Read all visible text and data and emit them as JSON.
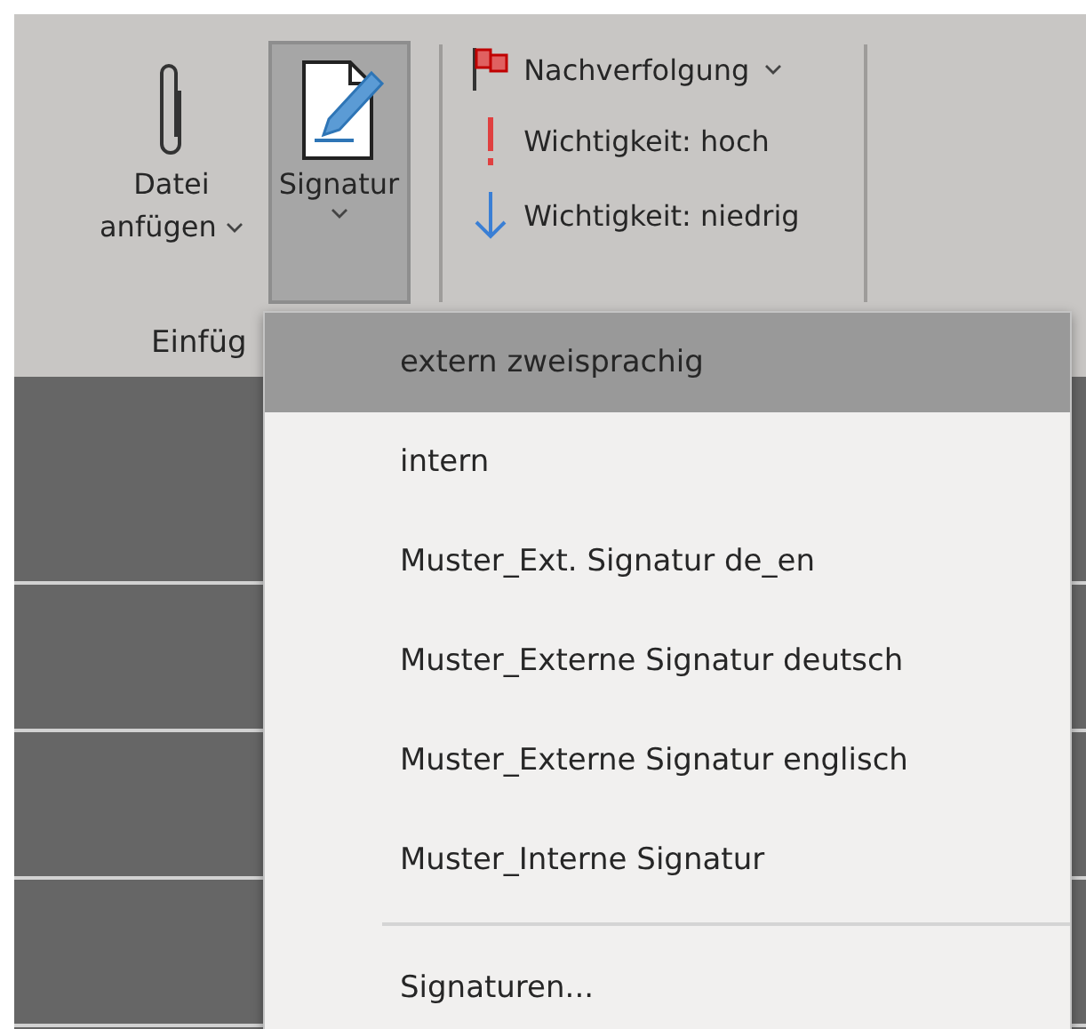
{
  "ribbon": {
    "large_buttons": [
      {
        "kind": "paperclip",
        "lines": [
          "Datei",
          "anfügen"
        ],
        "has_menu": true,
        "selected": false
      },
      {
        "kind": "signature",
        "lines": [
          "Signatur"
        ],
        "has_menu": true,
        "selected": true
      }
    ],
    "group_label": "Einfüg",
    "small_buttons": [
      {
        "kind": "flag",
        "label": "Nachverfolgung",
        "has_menu": true
      },
      {
        "kind": "high",
        "label": "Wichtigkeit: hoch",
        "has_menu": false
      },
      {
        "kind": "low",
        "label": "Wichtigkeit: niedrig",
        "has_menu": false
      }
    ]
  },
  "menu": {
    "items": [
      {
        "label": "extern zweisprachig",
        "selected": true
      },
      {
        "label": "intern",
        "selected": false
      },
      {
        "label": "Muster_Ext. Signatur de_en",
        "selected": false
      },
      {
        "label": "Muster_Externe Signatur deutsch",
        "selected": false
      },
      {
        "label": "Muster_Externe Signatur englisch",
        "selected": false
      },
      {
        "label": "Muster_Interne Signatur",
        "selected": false
      }
    ],
    "footer": "Signaturen..."
  }
}
